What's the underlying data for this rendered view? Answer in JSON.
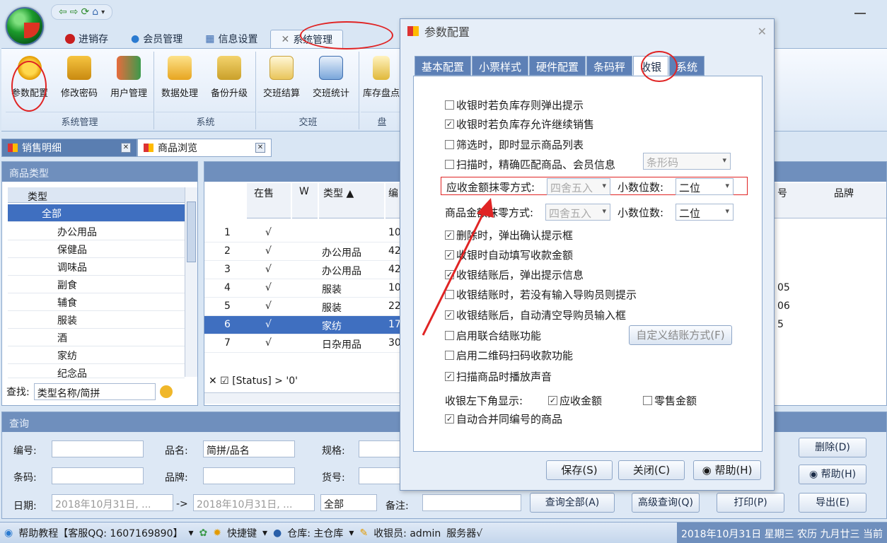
{
  "ribbon_tabs": [
    "进销存",
    "会员管理",
    "信息设置",
    "系统管理"
  ],
  "ribbon": {
    "buttons": [
      "参数配置",
      "修改密码",
      "用户管理",
      "数据处理",
      "备份升级",
      "交班结算",
      "交班统计",
      "库存盘点"
    ],
    "groups": [
      "系统管理",
      "系统",
      "交班",
      "盘"
    ]
  },
  "doc_tabs": [
    "销售明细",
    "商品浏览"
  ],
  "left": {
    "header": "商品类型",
    "col": "类型",
    "all": "全部",
    "items": [
      "办公用品",
      "保健品",
      "调味品",
      "副食",
      "辅食",
      "服装",
      "酒",
      "家纺",
      "纪念品"
    ],
    "find_label": "查找:",
    "find_placeholder": "类型名称/简拼"
  },
  "grid": {
    "cols": [
      "在售",
      "W",
      "类型",
      "编"
    ],
    "right_cols": [
      "号",
      "品牌"
    ],
    "rows": [
      {
        "n": "1",
        "s": "√",
        "t": "",
        "c": "10",
        "r": ""
      },
      {
        "n": "2",
        "s": "√",
        "t": "办公用品",
        "c": "42",
        "r": ""
      },
      {
        "n": "3",
        "s": "√",
        "t": "办公用品",
        "c": "42",
        "r": ""
      },
      {
        "n": "4",
        "s": "√",
        "t": "服装",
        "c": "10",
        "r": "05"
      },
      {
        "n": "5",
        "s": "√",
        "t": "服装",
        "c": "22",
        "r": "06"
      },
      {
        "n": "6",
        "s": "√",
        "t": "家纺",
        "c": "17",
        "r": "5"
      },
      {
        "n": "7",
        "s": "√",
        "t": "日杂用品",
        "c": "30",
        "r": ""
      }
    ],
    "filter": "[Status] > '0'"
  },
  "query": {
    "title": "查询",
    "labels": [
      "编号:",
      "品名:",
      "规格:",
      "条码:",
      "品牌:",
      "货号:",
      "日期:",
      "备注:"
    ],
    "pinming": "简拼/品名",
    "date1": "2018年10月31日, ...",
    "arrow": "->",
    "date2": "2018年10月31日, ...",
    "all": "全部",
    "buttons": [
      "查询全部(A)",
      "高级查询(Q)",
      "打印(P)",
      "删除(D)",
      "帮助(H)",
      "导出(E)"
    ]
  },
  "status": {
    "help": "帮助教程【客服QQ: 1607169890】",
    "quick": "快捷键",
    "store": "仓库: 主仓库",
    "cashier": "收银员: admin",
    "server": "服务器√",
    "date": "2018年10月31日 星期三 农历 九月廿三 当前"
  },
  "dialog": {
    "title": "参数配置",
    "tabs": [
      "基本配置",
      "小票样式",
      "硬件配置",
      "条码秤",
      "收银",
      "系统"
    ],
    "options": [
      {
        "label": "收银时若负库存则弹出提示",
        "checked": false
      },
      {
        "label": "收银时若负库存允许继续销售",
        "checked": true
      },
      {
        "label": "筛选时，即时显示商品列表",
        "checked": false
      },
      {
        "label": "扫描时，精确匹配商品、会员信息",
        "checked": false
      }
    ],
    "barcode": "条形码",
    "round1_label": "应收金额抹零方式:",
    "round1_val": "四舍五入",
    "dec_label": "小数位数:",
    "dec1": "二位",
    "round2_label": "商品金额抹零方式:",
    "round2_val": "四舍五入",
    "dec2": "二位",
    "options2": [
      {
        "label": "删除时，弹出确认提示框",
        "checked": true
      },
      {
        "label": "收银时自动填写收款金额",
        "checked": true
      },
      {
        "label": "收银结账后，弹出提示信息",
        "checked": true
      },
      {
        "label": "收银结账时，若没有输入导购员则提示",
        "checked": false
      },
      {
        "label": "收银结账后，自动清空导购员输入框",
        "checked": true
      },
      {
        "label": "启用联合结账功能",
        "checked": false
      },
      {
        "label": "启用二维码扫码收款功能",
        "checked": false
      },
      {
        "label": "扫描商品时播放声音",
        "checked": true
      }
    ],
    "custom_btn": "自定义结账方式(F)",
    "corner_label": "收银左下角显示:",
    "corner1": "应收金额",
    "corner2": "零售金额",
    "merge": "自动合并同编号的商品",
    "save": "保存(S)",
    "close": "关闭(C)",
    "help": "帮助(H)"
  }
}
